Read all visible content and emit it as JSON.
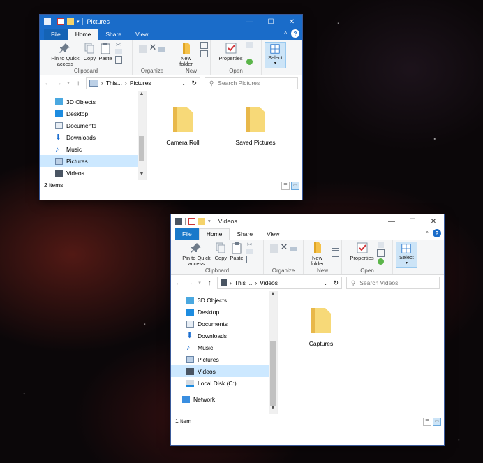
{
  "windows": [
    {
      "title": "Pictures",
      "tabs": {
        "file": "File",
        "home": "Home",
        "share": "Share",
        "view": "View"
      },
      "ribbon": {
        "pin": "Pin to Quick access",
        "copy": "Copy",
        "paste": "Paste",
        "clipboard": "Clipboard",
        "organize": "Organize",
        "new_folder": "New folder",
        "new": "New",
        "properties": "Properties",
        "open": "Open",
        "select": "Select"
      },
      "address": {
        "crumb1": "This...",
        "crumb2": "Pictures"
      },
      "search_placeholder": "Search Pictures",
      "nav": [
        "3D Objects",
        "Desktop",
        "Documents",
        "Downloads",
        "Music",
        "Pictures",
        "Videos"
      ],
      "selected_nav": "Pictures",
      "folders": [
        "Camera Roll",
        "Saved Pictures"
      ],
      "status": "2 items"
    },
    {
      "title": "Videos",
      "tabs": {
        "file": "File",
        "home": "Home",
        "share": "Share",
        "view": "View"
      },
      "ribbon": {
        "pin": "Pin to Quick access",
        "copy": "Copy",
        "paste": "Paste",
        "clipboard": "Clipboard",
        "organize": "Organize",
        "new_folder": "New folder",
        "new": "New",
        "properties": "Properties",
        "open": "Open",
        "select": "Select"
      },
      "address": {
        "crumb1": "This ...",
        "crumb2": "Videos"
      },
      "search_placeholder": "Search Videos",
      "nav": [
        "3D Objects",
        "Desktop",
        "Documents",
        "Downloads",
        "Music",
        "Pictures",
        "Videos",
        "Local Disk (C:)",
        "Network"
      ],
      "selected_nav": "Videos",
      "folders": [
        "Captures"
      ],
      "status": "1 item"
    }
  ],
  "colors": {
    "titlebar_active": "#1a6cc9",
    "selection": "#cce8ff",
    "folder": "#f5d36b"
  }
}
